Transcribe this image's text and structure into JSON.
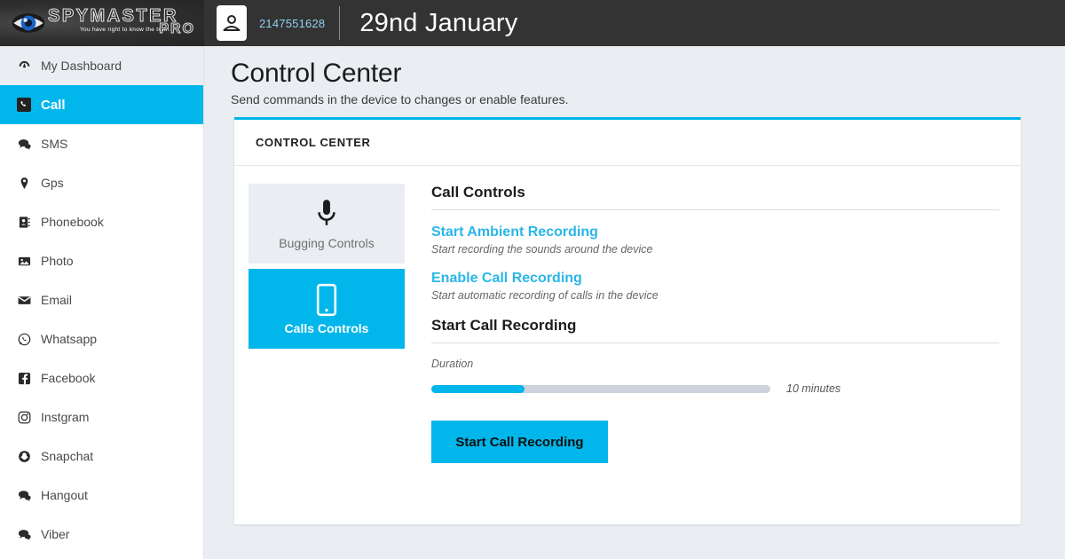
{
  "header": {
    "logo": {
      "brand": "SPYMASTER",
      "brand_suffix": "PRO",
      "tagline": "You have right to know the truth",
      "icon": "eye-logo-icon"
    },
    "user_icon": "contact-person-icon",
    "phone_number": "2147551628",
    "date": "29nd January",
    "bar_color": "#333333",
    "phone_number_color": "#8fd3ef"
  },
  "sidebar": {
    "items": [
      {
        "label": "My Dashboard",
        "icon": "dashboard-icon",
        "state": "shaded"
      },
      {
        "label": "Call",
        "icon": "phone-icon",
        "state": "active"
      },
      {
        "label": "SMS",
        "icon": "chat-bubbles-icon",
        "state": "normal"
      },
      {
        "label": "Gps",
        "icon": "map-pin-icon",
        "state": "normal"
      },
      {
        "label": "Phonebook",
        "icon": "address-book-icon",
        "state": "normal"
      },
      {
        "label": "Photo",
        "icon": "image-icon",
        "state": "normal"
      },
      {
        "label": "Email",
        "icon": "envelope-icon",
        "state": "normal"
      },
      {
        "label": "Whatsapp",
        "icon": "whatsapp-icon",
        "state": "normal"
      },
      {
        "label": "Facebook",
        "icon": "facebook-icon",
        "state": "normal"
      },
      {
        "label": "Instgram",
        "icon": "instagram-icon",
        "state": "normal"
      },
      {
        "label": "Snapchat",
        "icon": "snapchat-icon",
        "state": "normal"
      },
      {
        "label": "Hangout",
        "icon": "chat-bubbles-icon",
        "state": "normal"
      },
      {
        "label": "Viber",
        "icon": "chat-bubbles-icon",
        "state": "normal"
      }
    ],
    "active_color": "#00b6ea"
  },
  "main": {
    "title": "Control Center",
    "subtitle": "Send commands in the device to changes or enable features.",
    "panel": {
      "header": "CONTROL CENTER",
      "accent_color": "#00b6ea",
      "tabs": [
        {
          "label": "Bugging Controls",
          "icon": "microphone-icon",
          "active": false
        },
        {
          "label": "Calls Controls",
          "icon": "mobile-phone-icon",
          "active": true
        }
      ],
      "sections": [
        {
          "title": "Call Controls",
          "commands": [
            {
              "label": "Start Ambient Recording",
              "description": "Start recording the sounds around the device"
            },
            {
              "label": "Enable Call Recording",
              "description": "Start automatic recording of calls in the device"
            }
          ]
        },
        {
          "title": "Start Call Recording",
          "duration_label": "Duration",
          "duration_value": "10 minutes",
          "duration_percent": 27.5,
          "submit_label": "Start Call Recording"
        }
      ]
    }
  }
}
